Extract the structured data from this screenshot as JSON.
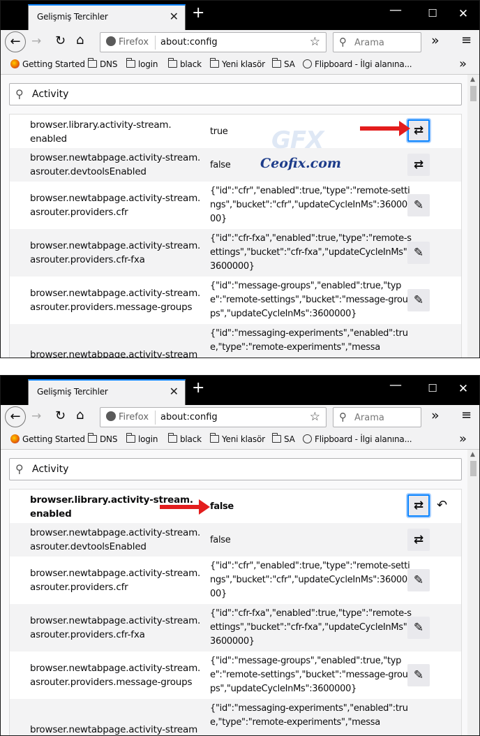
{
  "window": {
    "tab_title": "Gelişmiş Tercihler",
    "tab_close": "✕",
    "new_tab": "+",
    "min": "—",
    "max": "☐",
    "close": "✕"
  },
  "nav": {
    "back": "←",
    "forward": "→",
    "reload": "↻",
    "home": "⌂",
    "identity": "Firefox",
    "url": "about:config",
    "star": "☆",
    "search_placeholder": "Arama",
    "search_icon": "⚲",
    "overflow": "»",
    "menu": "≡"
  },
  "bookmarks": {
    "items": [
      "Getting Started",
      "DNS",
      "login",
      "black",
      "Yeni klasör",
      "SA",
      "Flipboard - İlgi alanına..."
    ],
    "more": "»"
  },
  "filter": {
    "icon": "⚲",
    "text": "Activity"
  },
  "watermark": {
    "big": "GFX",
    "text": "Ceofix.com"
  },
  "icons": {
    "toggle": "⇄",
    "edit": "✎",
    "reset": "↶",
    "scroll_up": "▲"
  },
  "frame1": {
    "rows": [
      {
        "name": "browser.library.activity-stream. enabled",
        "value": "true"
      },
      {
        "name": "browser.newtabpage.activity-stream. asrouter.devtoolsEnabled",
        "value": "false"
      },
      {
        "name": "browser.newtabpage.activity-stream. asrouter.providers.cfr",
        "value": "{\"id\":\"cfr\",\"enabled\":true,\"type\":\"remote-settings\",\"bucket\":\"cfr\",\"updateCycleInMs\":3600000}"
      },
      {
        "name": "browser.newtabpage.activity-stream. asrouter.providers.cfr-fxa",
        "value": "{\"id\":\"cfr-fxa\",\"enabled\":true,\"type\":\"remote-settings\",\"bucket\":\"cfr-fxa\",\"updateCycleInMs\":3600000}"
      },
      {
        "name": "browser.newtabpage.activity-stream. asrouter.providers.message-groups",
        "value": "{\"id\":\"message-groups\",\"enabled\":true,\"type\":\"remote-settings\",\"bucket\":\"message-groups\",\"updateCycleInMs\":3600000}"
      },
      {
        "name": "browser.newtabpage.activity-stream",
        "value": "{\"id\":\"messaging-experiments\",\"enabled\":true,\"type\":\"remote-experiments\",\"messa"
      }
    ]
  },
  "frame2": {
    "rows": [
      {
        "name": "browser.library.activity-stream. enabled",
        "value": "false"
      },
      {
        "name": "browser.newtabpage.activity-stream. asrouter.devtoolsEnabled",
        "value": "false"
      },
      {
        "name": "browser.newtabpage.activity-stream. asrouter.providers.cfr",
        "value": "{\"id\":\"cfr\",\"enabled\":true,\"type\":\"remote-settings\",\"bucket\":\"cfr\",\"updateCycleInMs\":3600000}"
      },
      {
        "name": "browser.newtabpage.activity-stream. asrouter.providers.cfr-fxa",
        "value": "{\"id\":\"cfr-fxa\",\"enabled\":true,\"type\":\"remote-settings\",\"bucket\":\"cfr-fxa\",\"updateCycleInMs\":3600000}"
      },
      {
        "name": "browser.newtabpage.activity-stream. asrouter.providers.message-groups",
        "value": "{\"id\":\"message-groups\",\"enabled\":true,\"type\":\"remote-settings\",\"bucket\":\"message-groups\",\"updateCycleInMs\":3600000}"
      },
      {
        "name": "browser.newtabpage.activity-stream",
        "value": "{\"id\":\"messaging-experiments\",\"enabled\":true,\"type\":\"remote-experiments\",\"messa"
      }
    ]
  }
}
